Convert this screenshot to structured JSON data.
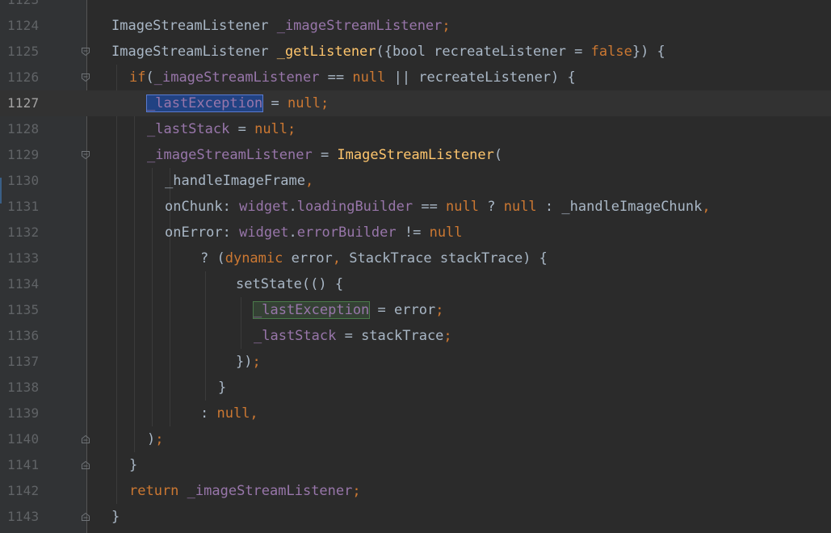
{
  "editor": {
    "top_partial_line": "1123",
    "lines": [
      {
        "num": "1124",
        "indent": 0,
        "fold": "none",
        "tokens": [
          [
            "plain",
            "ImageStreamListener "
          ],
          [
            "field",
            "_imageStreamListener"
          ],
          [
            "kw",
            ";"
          ]
        ]
      },
      {
        "num": "1125",
        "indent": 0,
        "fold": "start",
        "tokens": [
          [
            "plain",
            "ImageStreamListener "
          ],
          [
            "fn",
            "_getListener"
          ],
          [
            "plain",
            "({bool recreateListener = "
          ],
          [
            "kw",
            "false"
          ],
          [
            "plain",
            "}) {"
          ]
        ]
      },
      {
        "num": "1126",
        "indent": 1,
        "fold": "start",
        "tokens": [
          [
            "kw",
            "if"
          ],
          [
            "plain",
            "("
          ],
          [
            "field",
            "_imageStreamListener"
          ],
          [
            "plain",
            " == "
          ],
          [
            "kw",
            "null"
          ],
          [
            "plain",
            " || recreateListener) {"
          ]
        ]
      },
      {
        "num": "1127",
        "indent": 2,
        "fold": "none",
        "current": true,
        "tokens": [
          [
            "field-sel",
            "_lastException"
          ],
          [
            "plain",
            " = "
          ],
          [
            "kw",
            "null;"
          ]
        ]
      },
      {
        "num": "1128",
        "indent": 2,
        "fold": "none",
        "tokens": [
          [
            "field",
            "_lastStack"
          ],
          [
            "plain",
            " = "
          ],
          [
            "kw",
            "null;"
          ]
        ]
      },
      {
        "num": "1129",
        "indent": 2,
        "fold": "start",
        "tokens": [
          [
            "field",
            "_imageStreamListener"
          ],
          [
            "plain",
            " = "
          ],
          [
            "fn",
            "ImageStreamListener"
          ],
          [
            "plain",
            "("
          ]
        ]
      },
      {
        "num": "1130",
        "indent": 3,
        "fold": "none",
        "tokens": [
          [
            "plain",
            "_handleImageFrame"
          ],
          [
            "kw",
            ","
          ]
        ]
      },
      {
        "num": "1131",
        "indent": 3,
        "fold": "none",
        "tokens": [
          [
            "plain",
            "onChunk: "
          ],
          [
            "field",
            "widget"
          ],
          [
            "plain",
            "."
          ],
          [
            "field",
            "loadingBuilder"
          ],
          [
            "plain",
            " == "
          ],
          [
            "kw",
            "null"
          ],
          [
            "plain",
            " ? "
          ],
          [
            "kw",
            "null"
          ],
          [
            "plain",
            " : _handleImageChunk"
          ],
          [
            "kw",
            ","
          ]
        ]
      },
      {
        "num": "1132",
        "indent": 3,
        "fold": "none",
        "tokens": [
          [
            "plain",
            "onError: "
          ],
          [
            "field",
            "widget"
          ],
          [
            "plain",
            "."
          ],
          [
            "field",
            "errorBuilder"
          ],
          [
            "plain",
            " != "
          ],
          [
            "kw",
            "null"
          ]
        ]
      },
      {
        "num": "1133",
        "indent": 5,
        "fold": "none",
        "tokens": [
          [
            "plain",
            "? ("
          ],
          [
            "kw",
            "dynamic"
          ],
          [
            "plain",
            " error"
          ],
          [
            "kw",
            ","
          ],
          [
            "plain",
            " StackTrace stackTrace) {"
          ]
        ]
      },
      {
        "num": "1134",
        "indent": 7,
        "fold": "none",
        "tokens": [
          [
            "plain",
            "setState(() {"
          ]
        ]
      },
      {
        "num": "1135",
        "indent": 8,
        "fold": "none",
        "tokens": [
          [
            "field-write",
            "_lastException"
          ],
          [
            "plain",
            " = error"
          ],
          [
            "kw",
            ";"
          ]
        ]
      },
      {
        "num": "1136",
        "indent": 8,
        "fold": "none",
        "tokens": [
          [
            "field",
            "_lastStack"
          ],
          [
            "plain",
            " = stackTrace"
          ],
          [
            "kw",
            ";"
          ]
        ]
      },
      {
        "num": "1137",
        "indent": 7,
        "fold": "none",
        "tokens": [
          [
            "plain",
            "})"
          ],
          [
            "kw",
            ";"
          ]
        ]
      },
      {
        "num": "1138",
        "indent": 6,
        "fold": "none",
        "tokens": [
          [
            "plain",
            "}"
          ]
        ]
      },
      {
        "num": "1139",
        "indent": 5,
        "fold": "none",
        "tokens": [
          [
            "plain",
            ": "
          ],
          [
            "kw",
            "null,"
          ]
        ]
      },
      {
        "num": "1140",
        "indent": 2,
        "fold": "end",
        "tokens": [
          [
            "plain",
            ")"
          ],
          [
            "kw",
            ";"
          ]
        ]
      },
      {
        "num": "1141",
        "indent": 1,
        "fold": "end",
        "tokens": [
          [
            "plain",
            "}"
          ]
        ]
      },
      {
        "num": "1142",
        "indent": 1,
        "fold": "none",
        "tokens": [
          [
            "kw",
            "return"
          ],
          [
            "plain",
            " "
          ],
          [
            "field",
            "_imageStreamListener"
          ],
          [
            "kw",
            ";"
          ]
        ]
      },
      {
        "num": "1143",
        "indent": 0,
        "fold": "end",
        "tokens": [
          [
            "plain",
            "}"
          ]
        ]
      }
    ]
  },
  "colors": {
    "background": "#2b2b2b",
    "gutter": "#313335",
    "keyword": "#cc7832",
    "field": "#9876aa",
    "function": "#ffc66d",
    "text": "#a9b7c6",
    "line_number": "#606366",
    "selection": "#214283",
    "write_highlight": "#344134"
  },
  "icons": {
    "fold_start": "fold-open-icon",
    "fold_end": "fold-end-icon"
  }
}
